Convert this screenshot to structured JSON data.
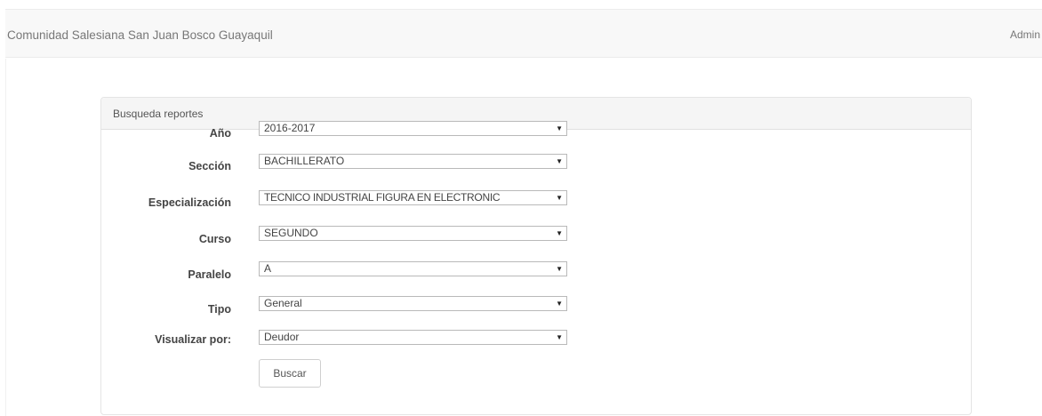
{
  "navbar": {
    "brand": "Comunidad Salesiana San Juan Bosco Guayaquil",
    "user": "Admin"
  },
  "panel": {
    "title": "Busqueda reportes"
  },
  "form": {
    "fields": [
      {
        "label": "Año",
        "value": "2016-2017"
      },
      {
        "label": "Sección",
        "value": "BACHILLERATO"
      },
      {
        "label": "Especialización",
        "value": "TECNICO INDUSTRIAL FIGURA EN ELECTRONIC"
      },
      {
        "label": "Curso",
        "value": "SEGUNDO"
      },
      {
        "label": "Paralelo",
        "value": "A"
      },
      {
        "label": "Tipo",
        "value": "General"
      },
      {
        "label": "Visualizar por:",
        "value": "Deudor"
      }
    ],
    "search_button": "Buscar"
  },
  "icons": {
    "select_arrow": "chevron-down-icon"
  }
}
